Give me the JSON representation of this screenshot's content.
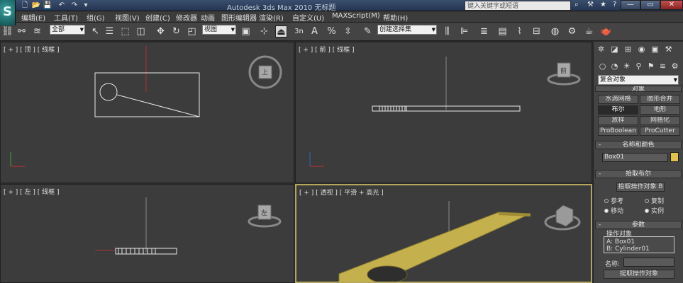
{
  "window": {
    "title": "Autodesk 3ds Max  2010      无标题",
    "search_placeholder": "键入关键字或短语",
    "logo_glyph": "S",
    "controls": {
      "min": "—",
      "max": "▭",
      "close": "✕"
    }
  },
  "menubar": {
    "items": [
      "编辑(E)",
      "工具(T)",
      "组(G)",
      "视图(V)",
      "创建(C)",
      "修改器",
      "动画",
      "图形编辑器",
      "渲染(R)",
      "自定义(U)",
      "MAXScript(M)",
      "帮助(H)"
    ]
  },
  "toolbar": {
    "filter_dropdown": "全部",
    "coord_dropdown": "视图",
    "selection_set_dropdown": "创建选择集",
    "snap_label": "3n",
    "snap_angle_label": "A",
    "snap_percent_label": "%"
  },
  "viewports": {
    "top": {
      "label": "[ + ] [ 顶 ] [ 线框 ]",
      "cube_face": "上"
    },
    "front": {
      "label": "[ + ] [ 前 ] [ 线框 ]",
      "cube_face": "前"
    },
    "left": {
      "label": "[ + ] [ 左 ] [ 线框 ]",
      "cube_face": "左"
    },
    "persp": {
      "label": "[ + ] [ 透视 ] [ 平滑 + 高光 ]"
    },
    "colors": {
      "bg": "#3c3c3c",
      "wire": "#e8e8e8",
      "box_fill": "#c5b04e",
      "active_border": "#b4a65a"
    }
  },
  "command_panel": {
    "category_dropdown": "复合对象",
    "object_type_header_partial": "对象",
    "buttons": [
      [
        "水滴网格",
        "图形合并"
      ],
      [
        "布尔",
        "地形"
      ],
      [
        "放样",
        "网格化"
      ],
      [
        "ProBoolean",
        "ProCutter"
      ]
    ],
    "selected_button": "布尔",
    "name_color_header": "名称和颜色",
    "object_name": "Box01",
    "object_color": "#e3c24a",
    "pick_boolean_header": "拾取布尔",
    "pick_operand_button": "拾取操作对象 B",
    "radios": [
      {
        "label": "参考",
        "on": false
      },
      {
        "label": "复制",
        "on": false
      },
      {
        "label": "移动",
        "on": true
      },
      {
        "label": "实例",
        "on": true
      }
    ],
    "params_header": "参数",
    "operands_label": "操作对象",
    "operands": [
      "A: Box01",
      "B: Cylinder01"
    ],
    "name_label": "名称:",
    "extract_button": "提取操作对象"
  }
}
